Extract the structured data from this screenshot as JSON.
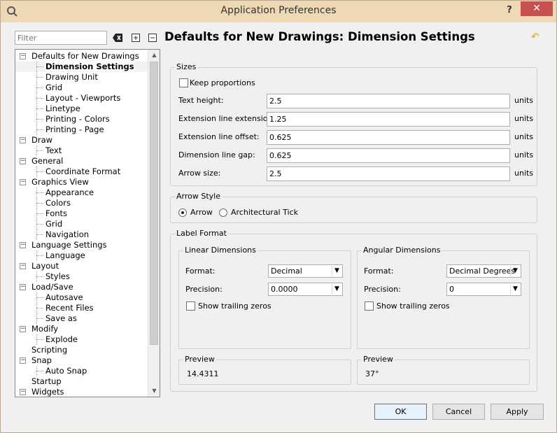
{
  "window": {
    "title": "Application Preferences",
    "help": "?",
    "close": "✕"
  },
  "filter": {
    "placeholder": "Filter"
  },
  "tree": {
    "items": [
      {
        "label": "Defaults for New Drawings",
        "level": 0,
        "expanded": true
      },
      {
        "label": "Dimension Settings",
        "level": 1,
        "selected": true
      },
      {
        "label": "Drawing Unit",
        "level": 1
      },
      {
        "label": "Grid",
        "level": 1
      },
      {
        "label": "Layout - Viewports",
        "level": 1
      },
      {
        "label": "Linetype",
        "level": 1
      },
      {
        "label": "Printing - Colors",
        "level": 1
      },
      {
        "label": "Printing - Page",
        "level": 1
      },
      {
        "label": "Draw",
        "level": 0,
        "expanded": true
      },
      {
        "label": "Text",
        "level": 1
      },
      {
        "label": "General",
        "level": 0,
        "expanded": true
      },
      {
        "label": "Coordinate Format",
        "level": 1
      },
      {
        "label": "Graphics View",
        "level": 0,
        "expanded": true
      },
      {
        "label": "Appearance",
        "level": 1
      },
      {
        "label": "Colors",
        "level": 1
      },
      {
        "label": "Fonts",
        "level": 1
      },
      {
        "label": "Grid",
        "level": 1
      },
      {
        "label": "Navigation",
        "level": 1
      },
      {
        "label": "Language Settings",
        "level": 0,
        "expanded": true
      },
      {
        "label": "Language",
        "level": 1
      },
      {
        "label": "Layout",
        "level": 0,
        "expanded": true
      },
      {
        "label": "Styles",
        "level": 1
      },
      {
        "label": "Load/Save",
        "level": 0,
        "expanded": true
      },
      {
        "label": "Autosave",
        "level": 1
      },
      {
        "label": "Recent Files",
        "level": 1
      },
      {
        "label": "Save as",
        "level": 1
      },
      {
        "label": "Modify",
        "level": 0,
        "expanded": true
      },
      {
        "label": "Explode",
        "level": 1
      },
      {
        "label": "Scripting",
        "level": 0,
        "leaf": true
      },
      {
        "label": "Snap",
        "level": 0,
        "expanded": true
      },
      {
        "label": "Auto Snap",
        "level": 1
      },
      {
        "label": "Startup",
        "level": 0,
        "leaf": true
      },
      {
        "label": "Widgets",
        "level": 0,
        "expanded": true
      }
    ]
  },
  "page": {
    "title": "Defaults for New Drawings: Dimension Settings"
  },
  "sizes": {
    "group_label": "Sizes",
    "keep_proportions": "Keep proportions",
    "rows": [
      {
        "label": "Text height:",
        "value": "2.5",
        "unit": "units"
      },
      {
        "label": "Extension line extension:",
        "value": "1.25",
        "unit": "units"
      },
      {
        "label": "Extension line offset:",
        "value": "0.625",
        "unit": "units"
      },
      {
        "label": "Dimension line gap:",
        "value": "0.625",
        "unit": "units"
      },
      {
        "label": "Arrow size:",
        "value": "2.5",
        "unit": "units"
      }
    ]
  },
  "arrow_style": {
    "group_label": "Arrow Style",
    "arrow": "Arrow",
    "tick": "Architectural Tick",
    "selected": "Arrow"
  },
  "label_format": {
    "group_label": "Label Format",
    "linear": {
      "group_label": "Linear Dimensions",
      "format_label": "Format:",
      "format_value": "Decimal",
      "precision_label": "Precision:",
      "precision_value": "0.0000",
      "trailing": "Show trailing zeros",
      "preview_label": "Preview",
      "preview_value": "14.4311"
    },
    "angular": {
      "group_label": "Angular Dimensions",
      "format_label": "Format:",
      "format_value": "Decimal Degrees",
      "precision_label": "Precision:",
      "precision_value": "0",
      "trailing": "Show trailing zeros",
      "preview_label": "Preview",
      "preview_value": "37°"
    }
  },
  "buttons": {
    "ok": "OK",
    "cancel": "Cancel",
    "apply": "Apply"
  }
}
